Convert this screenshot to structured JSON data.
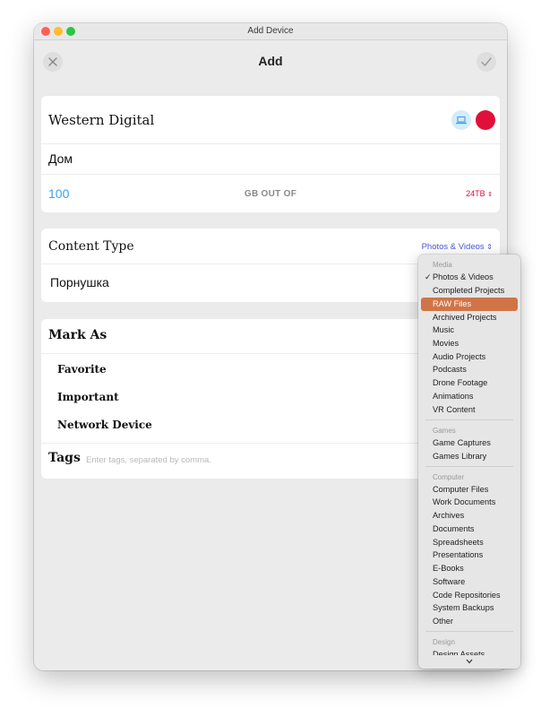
{
  "window": {
    "title": "Add Device"
  },
  "toolbar": {
    "title": "Add",
    "close_icon": "close-icon",
    "confirm_icon": "checkmark-icon"
  },
  "device": {
    "brand": "Western Digital",
    "name": "Дом",
    "capacity_value": "100",
    "capacity_middle": "GB OUT OF",
    "capacity_total": "24TB",
    "icon": "laptop-icon",
    "color": "#e0103a"
  },
  "content_type": {
    "label": "Content Type",
    "selected": "Photos & Videos",
    "value": "Порнушка"
  },
  "mark_as": {
    "label": "Mark As",
    "items": [
      "Favorite",
      "Important",
      "Network Device"
    ]
  },
  "tags": {
    "label": "Tags",
    "placeholder": "Enter tags, separated by comma."
  },
  "menu": {
    "groups": [
      {
        "header": "Media",
        "items": [
          "Photos & Videos",
          "Completed Projects",
          "RAW Files",
          "Archived Projects",
          "Music",
          "Movies",
          "Audio Projects",
          "Podcasts",
          "Drone Footage",
          "Animations",
          "VR Content"
        ]
      },
      {
        "header": "Games",
        "items": [
          "Game Captures",
          "Games Library"
        ]
      },
      {
        "header": "Computer",
        "items": [
          "Computer Files",
          "Work Documents",
          "Archives",
          "Documents",
          "Spreadsheets",
          "Presentations",
          "E-Books",
          "Software",
          "Code Repositories",
          "System Backups",
          "Other"
        ]
      },
      {
        "header": "Design",
        "items": [
          "Design Assets"
        ]
      }
    ],
    "checked": "Photos & Videos",
    "highlighted": "RAW Files"
  },
  "colors": {
    "accent_blue": "#3aa0e8",
    "accent_red": "#e0103a",
    "menu_highlight": "#d07448",
    "picker_blue": "#4a5ad6"
  }
}
